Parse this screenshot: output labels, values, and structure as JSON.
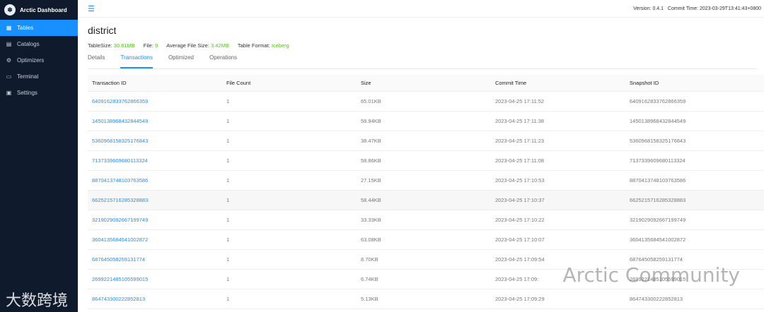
{
  "app": {
    "title": "Arctic Dashboard"
  },
  "sidebar": {
    "items": [
      {
        "label": "Tables",
        "icon": "table-icon"
      },
      {
        "label": "Catalogs",
        "icon": "catalog-icon"
      },
      {
        "label": "Optimizers",
        "icon": "optimizer-icon"
      },
      {
        "label": "Terminal",
        "icon": "terminal-icon"
      },
      {
        "label": "Settings",
        "icon": "settings-icon"
      }
    ]
  },
  "topbar": {
    "version": "Version: 0.4.1",
    "commit": "Commit Time: 2023-03-29T13:41:43+0800"
  },
  "page": {
    "title": "district",
    "meta": {
      "size_label": "TableSize:",
      "size_value": "30.81MB",
      "file_label": "File:",
      "file_value": "9",
      "avg_label": "Average File Size:",
      "avg_value": "3.42MB",
      "format_label": "Table Format:",
      "format_value": "Iceberg"
    },
    "tabs": [
      "Details",
      "Transactions",
      "Optimized",
      "Operations"
    ]
  },
  "table": {
    "columns": [
      "Transaction ID",
      "File Count",
      "Size",
      "Commit Time",
      "Snapshot ID"
    ],
    "rows": [
      [
        "6409162833762866359",
        "1",
        "65.01KB",
        "2023-04-25 17:11:52",
        "6409162833762866359"
      ],
      [
        "1450138968432844549",
        "1",
        "58.94KB",
        "2023-04-25 17:11:38",
        "1450138968432844549"
      ],
      [
        "5360968158325176843",
        "1",
        "38.47KB",
        "2023-04-25 17:11:23",
        "5360968158325176843"
      ],
      [
        "7137339609680113324",
        "1",
        "58.86KB",
        "2023-04-25 17:11:08",
        "7137339609680113324"
      ],
      [
        "8870413748103763586",
        "1",
        "27.15KB",
        "2023-04-25 17:10:53",
        "8870413748103763586"
      ],
      [
        "6625215716285328883",
        "1",
        "58.44KB",
        "2023-04-25 17:10:37",
        "6625215716285328883"
      ],
      [
        "3219029092667199749",
        "1",
        "33.33KB",
        "2023-04-25 17:10:22",
        "3219029092667199749"
      ],
      [
        "3604135684541002872",
        "1",
        "63.08KB",
        "2023-04-25 17:10:07",
        "3604135684541002872"
      ],
      [
        "687645058259131774",
        "1",
        "8.70KB",
        "2023-04-25 17:09:54",
        "687645058259131774"
      ],
      [
        "2699221485105599015",
        "1",
        "6.74KB",
        "2023-04-25 17:09:",
        "2699221485105599015"
      ],
      [
        "864743300222852813",
        "1",
        "5.13KB",
        "2023-04-25 17:09:29",
        "864743300222852813"
      ]
    ]
  },
  "watermarks": {
    "right": "Arctic Community",
    "left": "大数跨境"
  },
  "colors": {
    "sidebar_bg": "#0f1b2d",
    "accent": "#1890ff",
    "meta_value": "#52c41a"
  }
}
